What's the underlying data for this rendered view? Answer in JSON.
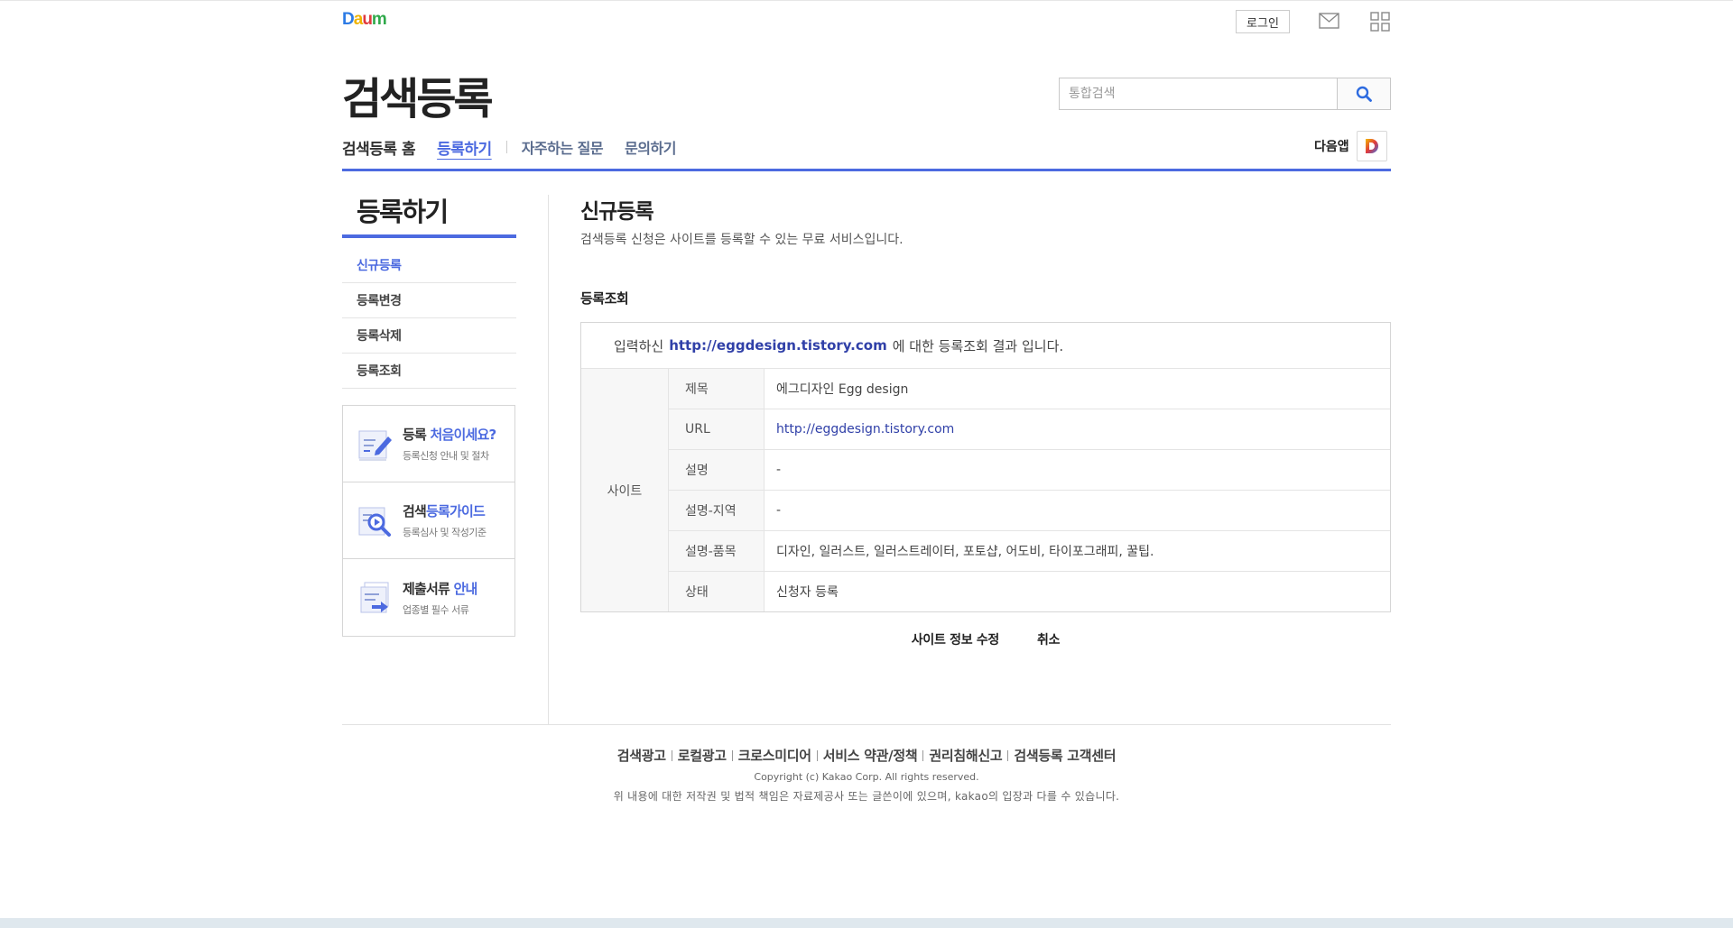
{
  "header": {
    "logo": [
      "D",
      "a",
      "u",
      "m"
    ],
    "login_label": "로그인",
    "mail_icon": "mail-icon",
    "apps_icon": "grid-icon",
    "page_title": "검색등록",
    "search_placeholder": "통합검색",
    "search_icon": "search-icon"
  },
  "gnb": {
    "home": "검색등록 홈",
    "register": "등록하기",
    "faq": "자주하는 질문",
    "contact": "문의하기",
    "daum_app": "다음앱"
  },
  "sidebar": {
    "title": "등록하기",
    "items": [
      {
        "label": "신규등록",
        "active": true
      },
      {
        "label": "등록변경",
        "active": false
      },
      {
        "label": "등록삭제",
        "active": false
      },
      {
        "label": "등록조회",
        "active": false
      }
    ],
    "banners": [
      {
        "title_a": "등록 ",
        "title_hl": "처음이세요?",
        "sub": "등록신청 안내 및 절차",
        "icon": "pencil-doc-icon"
      },
      {
        "title_a": "검색",
        "title_hl": "등록가이드",
        "sub": "등록심사 및 작성기준",
        "icon": "magnifier-doc-icon"
      },
      {
        "title_a": "제출서류 ",
        "title_hl": "안내",
        "sub": "업종별 필수 서류",
        "icon": "document-arrow-icon"
      }
    ]
  },
  "content": {
    "title": "신규등록",
    "desc": "검색등록 신청은 사이트를 등록할 수 있는 무료 서비스입니다.",
    "section": "등록조회",
    "result_prefix": "입력하신",
    "result_url": "http://eggdesign.tistory.com",
    "result_suffix": "에 대한 등록조회 결과 입니다.",
    "category": "사이트",
    "rows": [
      {
        "key": "제목",
        "value": "에그디자인 Egg design"
      },
      {
        "key": "URL",
        "value": "http://eggdesign.tistory.com"
      },
      {
        "key": "설명",
        "value": "-"
      },
      {
        "key": "설명-지역",
        "value": "-"
      },
      {
        "key": "설명-품목",
        "value": "디자인, 일러스트, 일러스트레이터, 포토샵, 어도비, 타이포그래피, 꿀팁."
      },
      {
        "key": "상태",
        "value": "신청자 등록"
      }
    ],
    "edit_label": "사이트 정보 수정",
    "cancel_label": "취소"
  },
  "footer": {
    "links": [
      "검색광고",
      "로컬광고",
      "크로스미디어",
      "서비스 약관/정책",
      "권리침해신고",
      "검색등록 고객센터"
    ],
    "copyright": "Copyright (c) Kakao Corp. All rights reserved.",
    "notice": "위 내용에 대한 저작권 및 법적 책임은 자료제공사 또는 글쓴이에 있으며, kakao의 입장과 다를 수 있습니다."
  },
  "colors": {
    "accent": "#4c6ae0",
    "link": "#3040a8"
  }
}
